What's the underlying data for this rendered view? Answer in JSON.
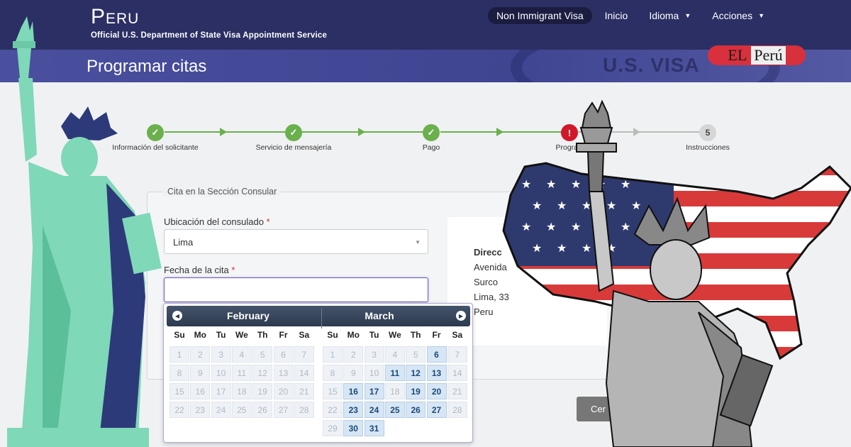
{
  "header": {
    "brand_title": "Peru",
    "brand_subtitle": "Official U.S. Department of State Visa Appointment Service",
    "nav": [
      {
        "label": "Non Immigrant Visa",
        "active": true
      },
      {
        "label": "Inicio"
      },
      {
        "label": "Idioma",
        "dropdown": true
      },
      {
        "label": "Acciones",
        "dropdown": true
      }
    ]
  },
  "banner": {
    "page_title": "Programar citas",
    "watermark_text": "U.S. VISA",
    "logo_text_1": "EL",
    "logo_text_2": "Perú"
  },
  "stepper": {
    "steps": [
      {
        "label": "Información del solicitante",
        "status": "done",
        "icon": "check-icon"
      },
      {
        "label": "Servicio de mensajería",
        "status": "done",
        "icon": "check-icon"
      },
      {
        "label": "Pago",
        "status": "done",
        "icon": "check-icon"
      },
      {
        "label": "Prograr",
        "status": "error",
        "icon": "exclamation-icon"
      },
      {
        "label": "Instrucciones",
        "status": "todo",
        "number": "5"
      }
    ]
  },
  "form": {
    "legend": "Cita en la Sección Consular",
    "consulate_label": "Ubicación del consulado",
    "consulate_value": "Lima",
    "date_label": "Fecha de la cita",
    "date_value": "",
    "required_mark": "*"
  },
  "address": {
    "heading": "Direcc",
    "lines": [
      "Avenida",
      "Surco",
      "Lima, 33",
      "Peru"
    ]
  },
  "datepicker": {
    "weekdays": [
      "Su",
      "Mo",
      "Tu",
      "We",
      "Th",
      "Fr",
      "Sa"
    ],
    "months": [
      {
        "name": "February",
        "weeks": [
          [
            "1",
            "2",
            "3",
            "4",
            "5",
            "6",
            "7"
          ],
          [
            "8",
            "9",
            "10",
            "11",
            "12",
            "13",
            "14"
          ],
          [
            "15",
            "16",
            "17",
            "18",
            "19",
            "20",
            "21"
          ],
          [
            "22",
            "23",
            "24",
            "25",
            "26",
            "27",
            "28"
          ]
        ],
        "available": []
      },
      {
        "name": "March",
        "weeks": [
          [
            "1",
            "2",
            "3",
            "4",
            "5",
            "6",
            "7"
          ],
          [
            "8",
            "9",
            "10",
            "11",
            "12",
            "13",
            "14"
          ],
          [
            "15",
            "16",
            "17",
            "18",
            "19",
            "20",
            "21"
          ],
          [
            "22",
            "23",
            "24",
            "25",
            "26",
            "27",
            "28"
          ],
          [
            "29",
            "30",
            "31"
          ]
        ],
        "available": [
          "6",
          "11",
          "12",
          "13",
          "16",
          "17",
          "19",
          "20",
          "23",
          "24",
          "25",
          "26",
          "27",
          "30",
          "31"
        ]
      }
    ]
  },
  "actions": {
    "partial_button": "Cer"
  },
  "colors": {
    "topbar": "#2b2f63",
    "band": "#464b99",
    "success": "#6ab04c",
    "error": "#d0182a"
  }
}
